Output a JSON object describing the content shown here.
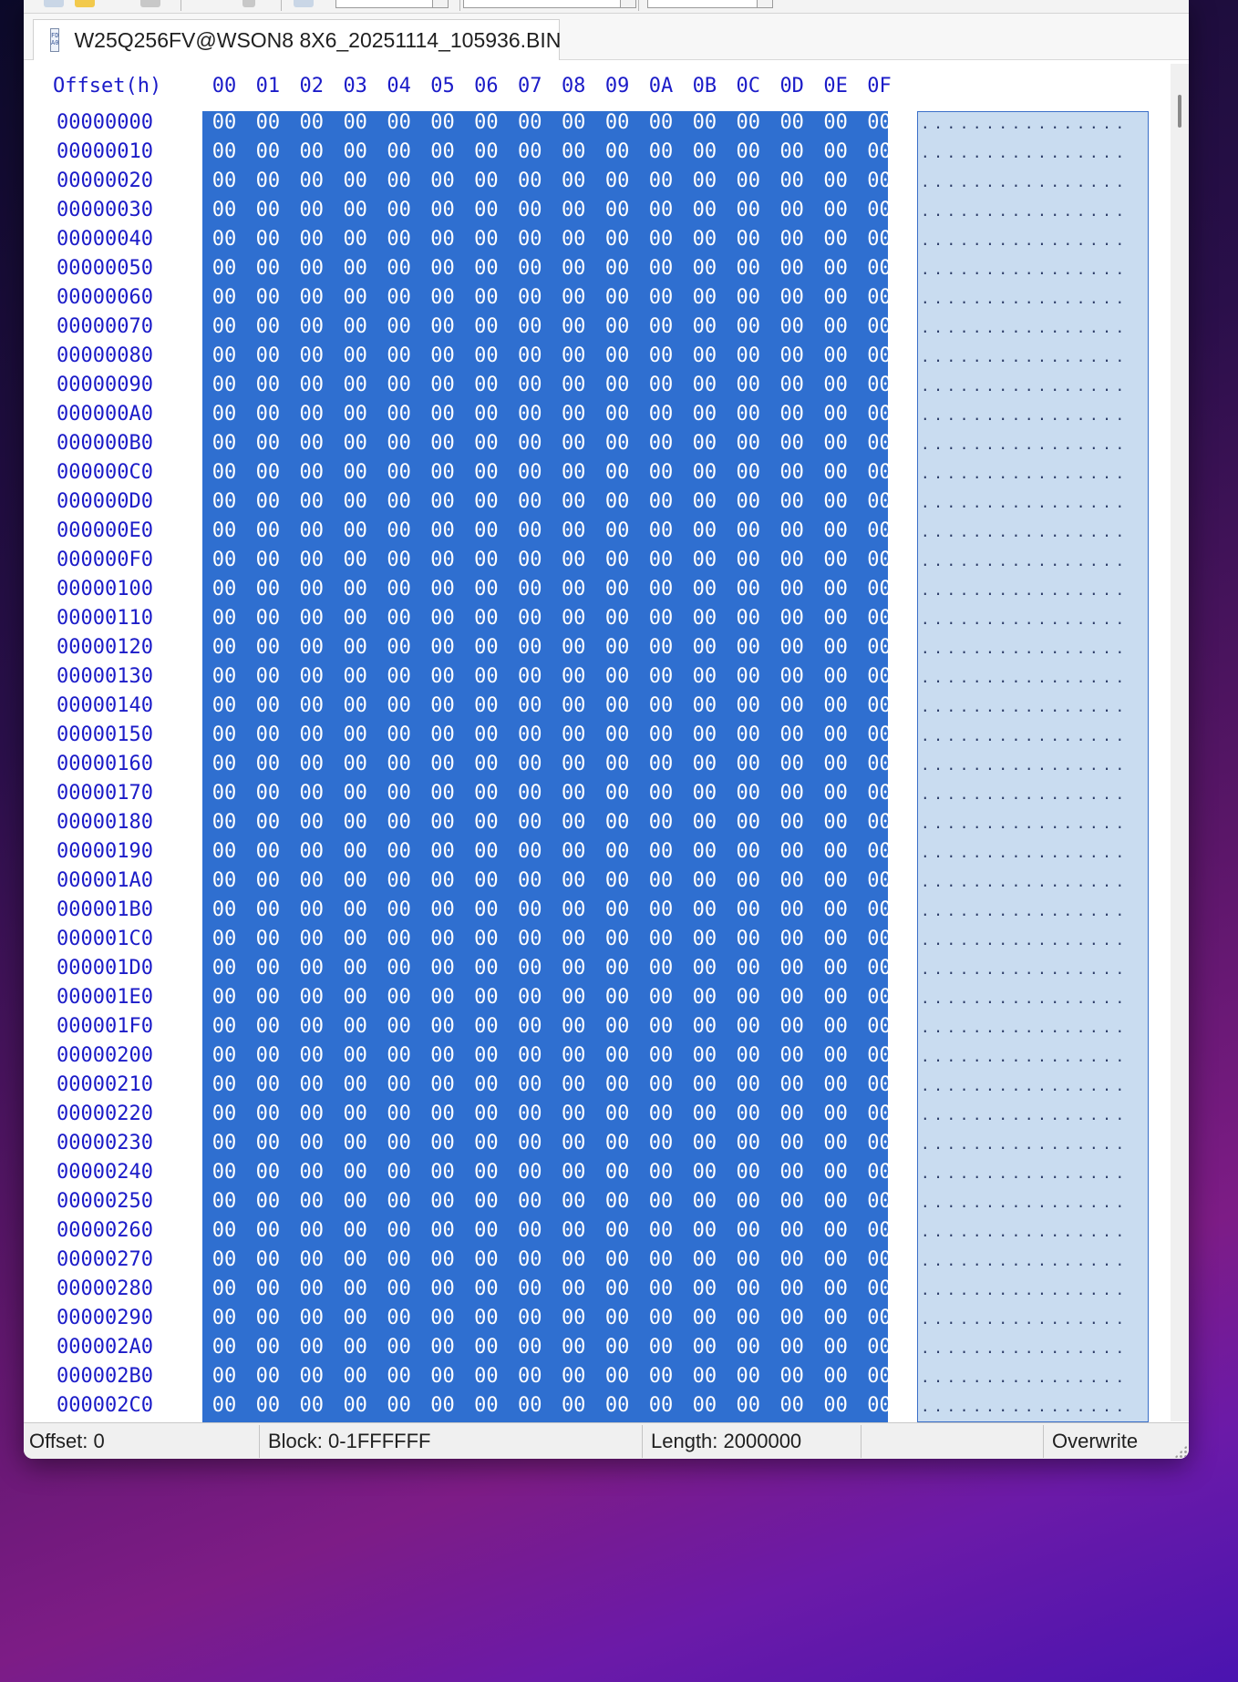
{
  "tab": {
    "filename": "W25Q256FV@WSON8 8X6_20251114_105936.BIN"
  },
  "file_icon_text": "FD\nA0",
  "header": {
    "offset_label": "Offset(h)",
    "columns": [
      "00",
      "01",
      "02",
      "03",
      "04",
      "05",
      "06",
      "07",
      "08",
      "09",
      "0A",
      "0B",
      "0C",
      "0D",
      "0E",
      "0F"
    ]
  },
  "rows": [
    {
      "offset": "00000000"
    },
    {
      "offset": "00000010"
    },
    {
      "offset": "00000020"
    },
    {
      "offset": "00000030"
    },
    {
      "offset": "00000040"
    },
    {
      "offset": "00000050"
    },
    {
      "offset": "00000060"
    },
    {
      "offset": "00000070"
    },
    {
      "offset": "00000080"
    },
    {
      "offset": "00000090"
    },
    {
      "offset": "000000A0"
    },
    {
      "offset": "000000B0"
    },
    {
      "offset": "000000C0"
    },
    {
      "offset": "000000D0"
    },
    {
      "offset": "000000E0"
    },
    {
      "offset": "000000F0"
    },
    {
      "offset": "00000100"
    },
    {
      "offset": "00000110"
    },
    {
      "offset": "00000120"
    },
    {
      "offset": "00000130"
    },
    {
      "offset": "00000140"
    },
    {
      "offset": "00000150"
    },
    {
      "offset": "00000160"
    },
    {
      "offset": "00000170"
    },
    {
      "offset": "00000180"
    },
    {
      "offset": "00000190"
    },
    {
      "offset": "000001A0"
    },
    {
      "offset": "000001B0"
    },
    {
      "offset": "000001C0"
    },
    {
      "offset": "000001D0"
    },
    {
      "offset": "000001E0"
    },
    {
      "offset": "000001F0"
    },
    {
      "offset": "00000200"
    },
    {
      "offset": "00000210"
    },
    {
      "offset": "00000220"
    },
    {
      "offset": "00000230"
    },
    {
      "offset": "00000240"
    },
    {
      "offset": "00000250"
    },
    {
      "offset": "00000260"
    },
    {
      "offset": "00000270"
    },
    {
      "offset": "00000280"
    },
    {
      "offset": "00000290"
    },
    {
      "offset": "000002A0"
    },
    {
      "offset": "000002B0"
    },
    {
      "offset": "000002C0"
    }
  ],
  "byte_value": "00",
  "ascii_row": "................",
  "status": {
    "offset": "Offset: 0",
    "block": "Block: 0-1FFFFFF",
    "length": "Length: 2000000",
    "mode": "Overwrite"
  },
  "colors": {
    "selection": "#2f6fd0",
    "ascii_selection": "#c9dcf0",
    "offset_text": "#1b1bc8"
  }
}
